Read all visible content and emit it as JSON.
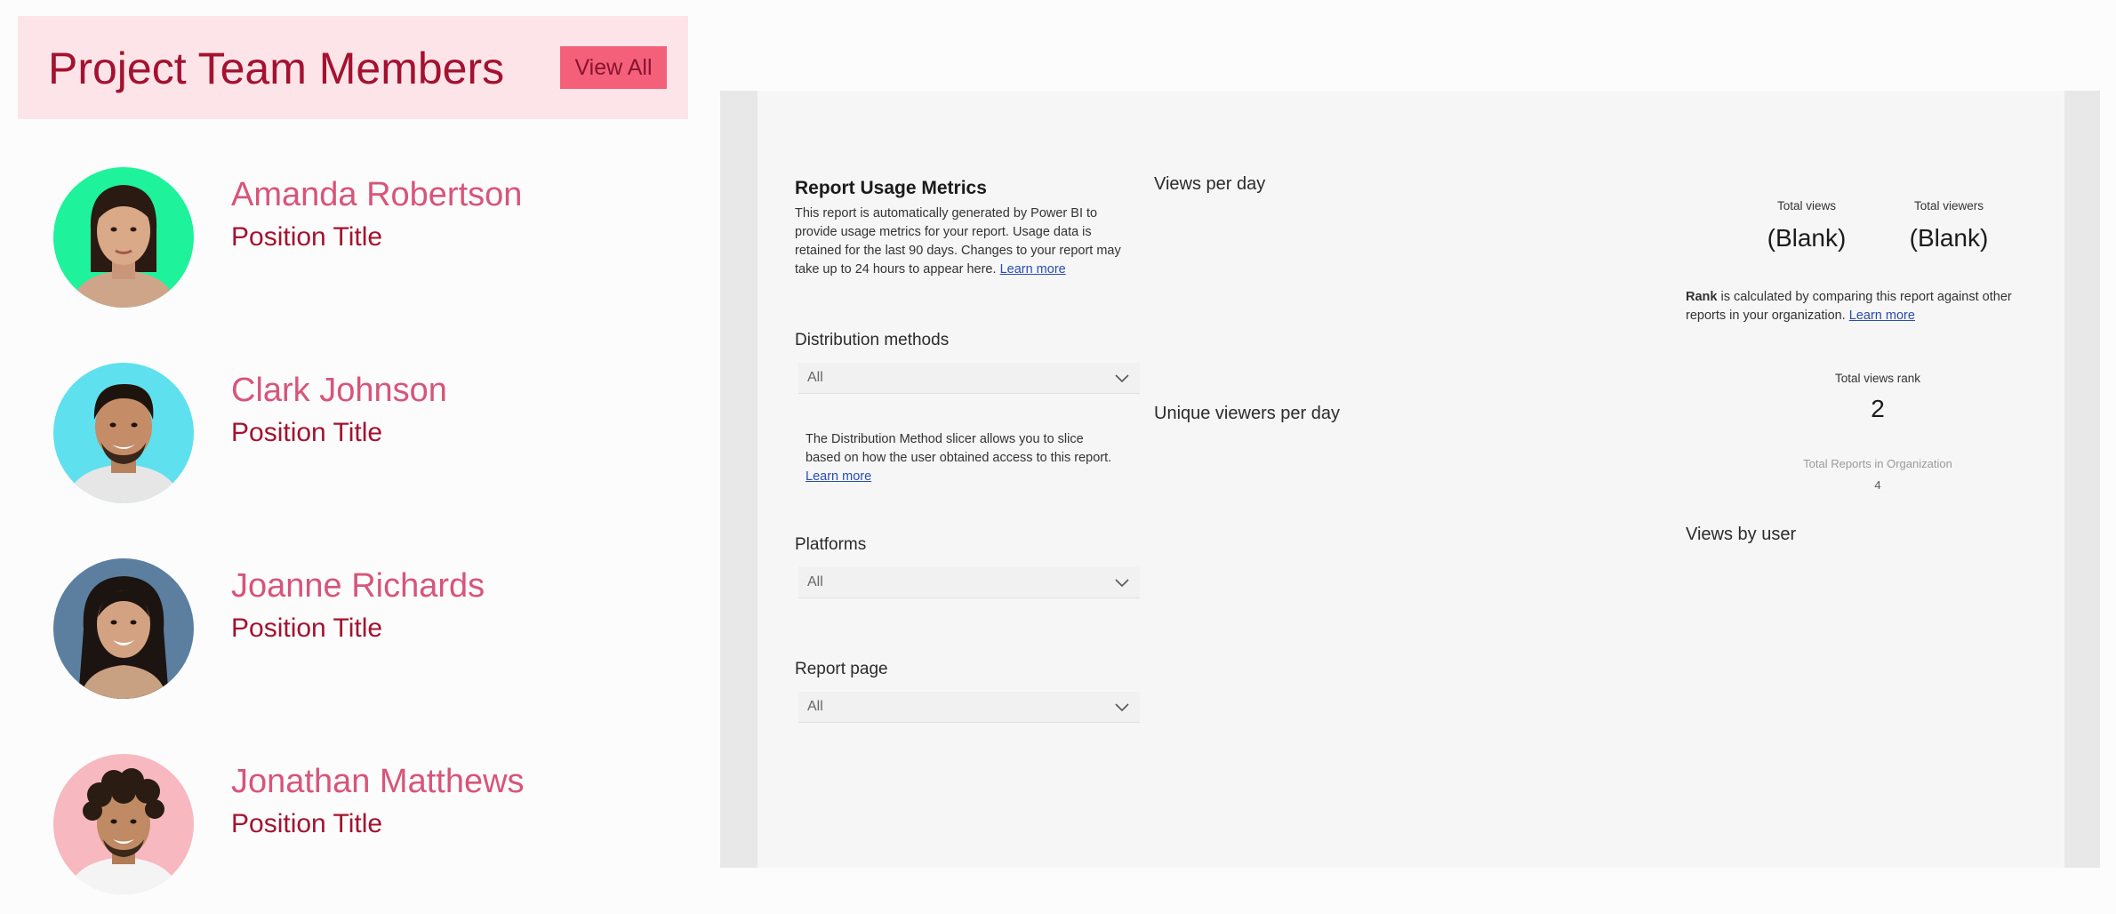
{
  "team": {
    "title": "Project Team Members",
    "view_all_label": "View All",
    "members": [
      {
        "name": "Amanda Robertson",
        "position": "Position Title",
        "avatar_bg": "#1ef29a"
      },
      {
        "name": "Clark Johnson",
        "position": "Position Title",
        "avatar_bg": "#5fe0ee"
      },
      {
        "name": "Joanne Richards",
        "position": "Position Title",
        "avatar_bg": "#5c7fa0"
      },
      {
        "name": "Jonathan Matthews",
        "position": "Position Title",
        "avatar_bg": "#f7b8c0"
      }
    ]
  },
  "report": {
    "title": "Report Usage Metrics",
    "description": "This report is automatically generated by Power BI to provide usage metrics for your report. Usage data is retained for the last 90 days. Changes to your report may take up to 24 hours to appear here.",
    "learn_more": "Learn more",
    "slicers": {
      "distribution": {
        "label": "Distribution methods",
        "value": "All"
      },
      "platforms": {
        "label": "Platforms",
        "value": "All"
      },
      "report_page": {
        "label": "Report page",
        "value": "All"
      }
    },
    "distribution_note": "The Distribution Method slicer allows you to slice based on how the user obtained access to this report.",
    "visuals": {
      "views_per_day": "Views per day",
      "unique_viewers_per_day": "Unique viewers per day",
      "views_by_user": "Views by user"
    },
    "cards": {
      "total_views": {
        "label": "Total views",
        "value": "(Blank)"
      },
      "total_viewers": {
        "label": "Total viewers",
        "value": "(Blank)"
      },
      "total_views_rank": {
        "label": "Total views rank",
        "value": "2"
      },
      "total_reports": {
        "label": "Total Reports in Organization",
        "value": "4"
      }
    },
    "rank_note": {
      "bold": "Rank",
      "text": " is calculated by comparing this report against other reports in your organization."
    }
  }
}
